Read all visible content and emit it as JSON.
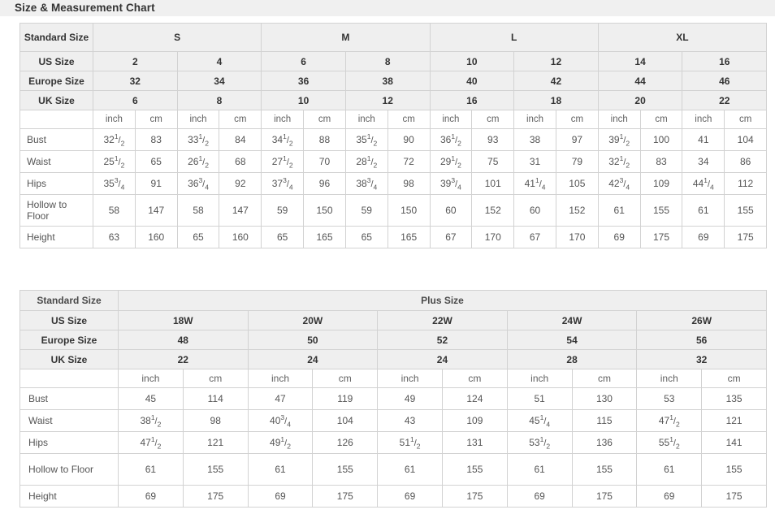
{
  "page": {
    "title": "Size & Measurement Chart"
  },
  "table1": {
    "corner_label": "Standard Size",
    "groups": [
      {
        "label": "S",
        "span": 4
      },
      {
        "label": "M",
        "span": 4
      },
      {
        "label": "L",
        "span": 4
      },
      {
        "label": "XL",
        "span": 4
      }
    ],
    "size_rows": [
      {
        "label": "US Size",
        "values": [
          "2",
          "4",
          "6",
          "8",
          "10",
          "12",
          "14",
          "16"
        ]
      },
      {
        "label": "Europe Size",
        "values": [
          "32",
          "34",
          "36",
          "38",
          "40",
          "42",
          "44",
          "46"
        ]
      },
      {
        "label": "UK Size",
        "values": [
          "6",
          "8",
          "10",
          "12",
          "16",
          "18",
          "20",
          "22"
        ]
      }
    ],
    "unit_row": {
      "label": "",
      "units": [
        "inch",
        "cm",
        "inch",
        "cm",
        "inch",
        "cm",
        "inch",
        "cm",
        "inch",
        "cm",
        "inch",
        "cm",
        "inch",
        "cm",
        "inch",
        "cm"
      ]
    },
    "measurements": [
      {
        "name": "Bust",
        "cells": [
          {
            "whole": "32",
            "num": "1",
            "den": "2"
          },
          {
            "plain": "83"
          },
          {
            "whole": "33",
            "num": "1",
            "den": "2"
          },
          {
            "plain": "84"
          },
          {
            "whole": "34",
            "num": "1",
            "den": "2"
          },
          {
            "plain": "88"
          },
          {
            "whole": "35",
            "num": "1",
            "den": "2"
          },
          {
            "plain": "90"
          },
          {
            "whole": "36",
            "num": "1",
            "den": "2"
          },
          {
            "plain": "93"
          },
          {
            "plain": "38"
          },
          {
            "plain": "97"
          },
          {
            "whole": "39",
            "num": "1",
            "den": "2"
          },
          {
            "plain": "100"
          },
          {
            "plain": "41"
          },
          {
            "plain": "104"
          }
        ]
      },
      {
        "name": "Waist",
        "cells": [
          {
            "whole": "25",
            "num": "1",
            "den": "2"
          },
          {
            "plain": "65"
          },
          {
            "whole": "26",
            "num": "1",
            "den": "2"
          },
          {
            "plain": "68"
          },
          {
            "whole": "27",
            "num": "1",
            "den": "2"
          },
          {
            "plain": "70"
          },
          {
            "whole": "28",
            "num": "1",
            "den": "2"
          },
          {
            "plain": "72"
          },
          {
            "whole": "29",
            "num": "1",
            "den": "2"
          },
          {
            "plain": "75"
          },
          {
            "plain": "31"
          },
          {
            "plain": "79"
          },
          {
            "whole": "32",
            "num": "1",
            "den": "2"
          },
          {
            "plain": "83"
          },
          {
            "plain": "34"
          },
          {
            "plain": "86"
          }
        ]
      },
      {
        "name": "Hips",
        "cells": [
          {
            "whole": "35",
            "num": "3",
            "den": "4"
          },
          {
            "plain": "91"
          },
          {
            "whole": "36",
            "num": "3",
            "den": "4"
          },
          {
            "plain": "92"
          },
          {
            "whole": "37",
            "num": "3",
            "den": "4"
          },
          {
            "plain": "96"
          },
          {
            "whole": "38",
            "num": "3",
            "den": "4"
          },
          {
            "plain": "98"
          },
          {
            "whole": "39",
            "num": "3",
            "den": "4"
          },
          {
            "plain": "101"
          },
          {
            "whole": "41",
            "num": "1",
            "den": "4"
          },
          {
            "plain": "105"
          },
          {
            "whole": "42",
            "num": "3",
            "den": "4"
          },
          {
            "plain": "109"
          },
          {
            "whole": "44",
            "num": "1",
            "den": "4"
          },
          {
            "plain": "112"
          }
        ]
      },
      {
        "name": "Hollow to Floor",
        "tall": true,
        "cells": [
          {
            "plain": "58"
          },
          {
            "plain": "147"
          },
          {
            "plain": "58"
          },
          {
            "plain": "147"
          },
          {
            "plain": "59"
          },
          {
            "plain": "150"
          },
          {
            "plain": "59"
          },
          {
            "plain": "150"
          },
          {
            "plain": "60"
          },
          {
            "plain": "152"
          },
          {
            "plain": "60"
          },
          {
            "plain": "152"
          },
          {
            "plain": "61"
          },
          {
            "plain": "155"
          },
          {
            "plain": "61"
          },
          {
            "plain": "155"
          }
        ]
      },
      {
        "name": "Height",
        "cells": [
          {
            "plain": "63"
          },
          {
            "plain": "160"
          },
          {
            "plain": "65"
          },
          {
            "plain": "160"
          },
          {
            "plain": "65"
          },
          {
            "plain": "165"
          },
          {
            "plain": "65"
          },
          {
            "plain": "165"
          },
          {
            "plain": "67"
          },
          {
            "plain": "170"
          },
          {
            "plain": "67"
          },
          {
            "plain": "170"
          },
          {
            "plain": "69"
          },
          {
            "plain": "175"
          },
          {
            "plain": "69"
          },
          {
            "plain": "175"
          }
        ]
      }
    ]
  },
  "table2": {
    "corner_label": "Standard Size",
    "group_label": "Plus Size",
    "size_rows": [
      {
        "label": "US Size",
        "values": [
          "18W",
          "20W",
          "22W",
          "24W",
          "26W"
        ]
      },
      {
        "label": "Europe Size",
        "values": [
          "48",
          "50",
          "52",
          "54",
          "56"
        ]
      },
      {
        "label": "UK Size",
        "values": [
          "22",
          "24",
          "24",
          "28",
          "32"
        ]
      }
    ],
    "unit_row": {
      "label": "",
      "units": [
        "inch",
        "cm",
        "inch",
        "cm",
        "inch",
        "cm",
        "inch",
        "cm",
        "inch",
        "cm"
      ]
    },
    "measurements": [
      {
        "name": "Bust",
        "cells": [
          {
            "plain": "45"
          },
          {
            "plain": "114"
          },
          {
            "plain": "47"
          },
          {
            "plain": "119"
          },
          {
            "plain": "49"
          },
          {
            "plain": "124"
          },
          {
            "plain": "51"
          },
          {
            "plain": "130"
          },
          {
            "plain": "53"
          },
          {
            "plain": "135"
          }
        ]
      },
      {
        "name": "Waist",
        "cells": [
          {
            "whole": "38",
            "num": "1",
            "den": "2"
          },
          {
            "plain": "98"
          },
          {
            "whole": "40",
            "num": "3",
            "den": "4"
          },
          {
            "plain": "104"
          },
          {
            "plain": "43"
          },
          {
            "plain": "109"
          },
          {
            "whole": "45",
            "num": "1",
            "den": "4"
          },
          {
            "plain": "115"
          },
          {
            "whole": "47",
            "num": "1",
            "den": "2"
          },
          {
            "plain": "121"
          }
        ]
      },
      {
        "name": "Hips",
        "cells": [
          {
            "whole": "47",
            "num": "1",
            "den": "2"
          },
          {
            "plain": "121"
          },
          {
            "whole": "49",
            "num": "1",
            "den": "2"
          },
          {
            "plain": "126"
          },
          {
            "whole": "51",
            "num": "1",
            "den": "2"
          },
          {
            "plain": "131"
          },
          {
            "whole": "53",
            "num": "1",
            "den": "2"
          },
          {
            "plain": "136"
          },
          {
            "whole": "55",
            "num": "1",
            "den": "2"
          },
          {
            "plain": "141"
          }
        ]
      },
      {
        "name": "Hollow to Floor",
        "tall": true,
        "cells": [
          {
            "plain": "61"
          },
          {
            "plain": "155"
          },
          {
            "plain": "61"
          },
          {
            "plain": "155"
          },
          {
            "plain": "61"
          },
          {
            "plain": "155"
          },
          {
            "plain": "61"
          },
          {
            "plain": "155"
          },
          {
            "plain": "61"
          },
          {
            "plain": "155"
          }
        ]
      },
      {
        "name": "Height",
        "cells": [
          {
            "plain": "69"
          },
          {
            "plain": "175"
          },
          {
            "plain": "69"
          },
          {
            "plain": "175"
          },
          {
            "plain": "69"
          },
          {
            "plain": "175"
          },
          {
            "plain": "69"
          },
          {
            "plain": "175"
          },
          {
            "plain": "69"
          },
          {
            "plain": "175"
          }
        ]
      }
    ]
  },
  "colors": {
    "header_bg": "#efefef",
    "border": "#d2d2d2",
    "title_bg": "#f0f0f0",
    "text": "#333333"
  }
}
